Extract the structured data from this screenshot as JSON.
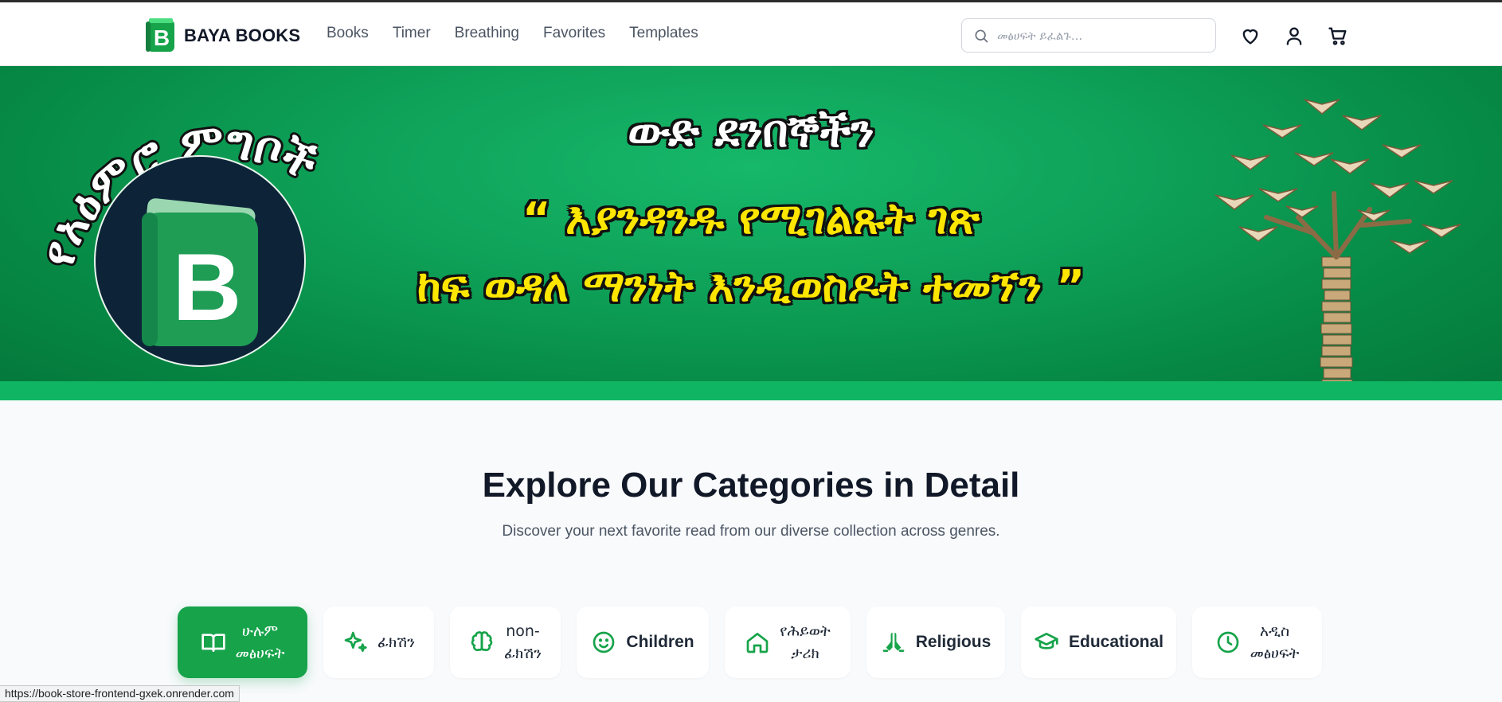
{
  "header": {
    "brand": "BAYA BOOKS",
    "brand_letter": "B",
    "nav": [
      "Books",
      "Timer",
      "Breathing",
      "Favorites",
      "Templates"
    ],
    "search_placeholder": "መፅሀፍት ይፈልጉ...",
    "icons": [
      "search-icon",
      "heart-icon",
      "user-icon",
      "cart-icon"
    ]
  },
  "hero": {
    "badge_arc_text": "የአዕምሮ ምግቦች",
    "line1": "ውድ ደንበኞችን",
    "line2": "“ እያንዳንዱ የሚገልጹት ገጽ",
    "line3": "ከፍ ወዳለ ማንነት እንዲወስዶት ተመኘን ”",
    "badge_letter": "B",
    "colors": {
      "green": "#0fa35a",
      "yellow": "#ffe600",
      "navy": "#0d2438"
    }
  },
  "categories_section": {
    "title": "Explore Our Categories in Detail",
    "subtitle": "Discover your next favorite read from our diverse collection across genres.",
    "items": [
      {
        "label_line1": "ሁሉም",
        "label_line2": "መፅሀፍት",
        "icon": "book-open-icon",
        "active": true
      },
      {
        "label_line1": "ፊክሽን",
        "label_line2": "",
        "icon": "sparkles-icon",
        "active": false
      },
      {
        "label_line1": "non-",
        "label_line2": "ፊክሽን",
        "icon": "brain-icon",
        "active": false
      },
      {
        "label_line1": "Children",
        "label_line2": "",
        "icon": "smile-icon",
        "active": false
      },
      {
        "label_line1": "የሕይወት",
        "label_line2": "ታሪክ",
        "icon": "home-icon",
        "active": false
      },
      {
        "label_line1": "Religious",
        "label_line2": "",
        "icon": "praying-hands-icon",
        "active": false
      },
      {
        "label_line1": "Educational",
        "label_line2": "",
        "icon": "graduation-cap-icon",
        "active": false
      },
      {
        "label_line1": "አዲስ",
        "label_line2": "መፅሀፍት",
        "icon": "clock-icon",
        "active": false
      }
    ]
  },
  "status_bar": {
    "url": "https://book-store-frontend-gxek.onrender.com"
  }
}
